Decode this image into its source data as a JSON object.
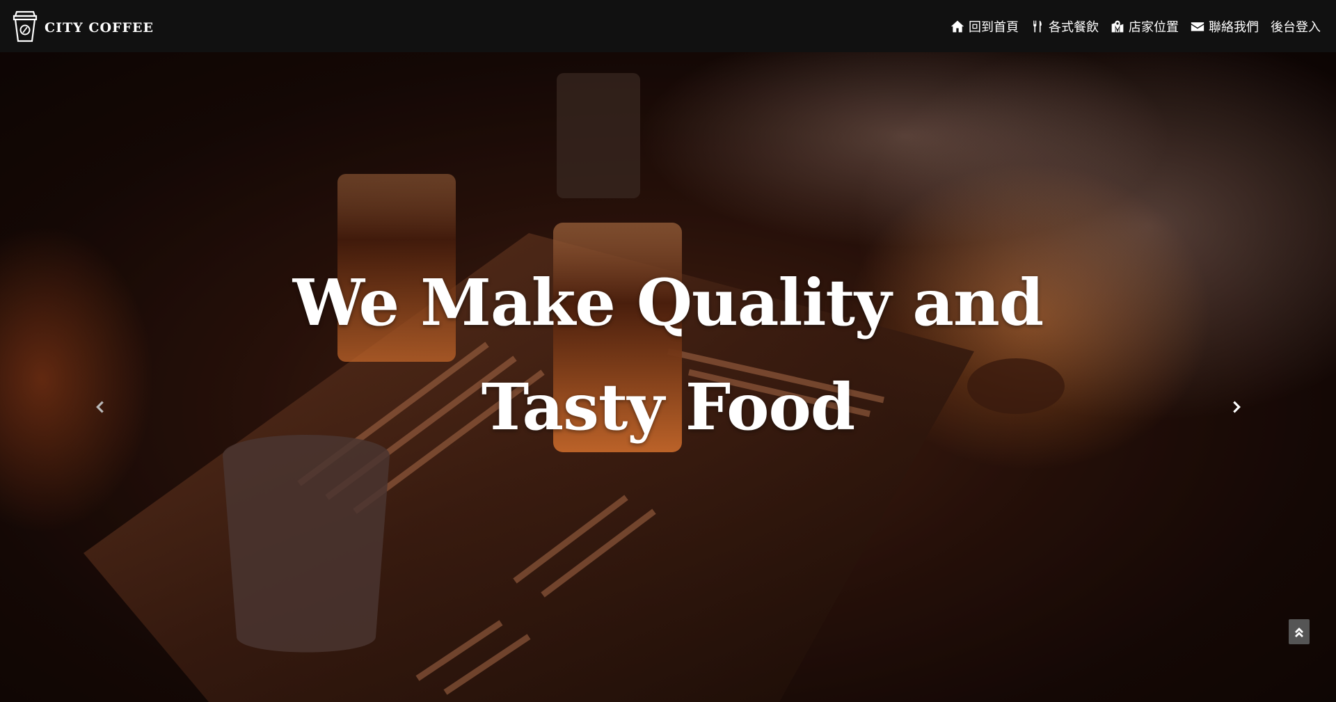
{
  "brand": {
    "name": "CITY COFFEE",
    "logo_icon": "coffee-cup-icon"
  },
  "nav": {
    "items": [
      {
        "label": "回到首頁",
        "icon": "home-icon"
      },
      {
        "label": "各式餐飲",
        "icon": "cutlery-icon"
      },
      {
        "label": "店家位置",
        "icon": "map-marker-icon"
      },
      {
        "label": "聯絡我們",
        "icon": "envelope-icon"
      },
      {
        "label": "後台登入",
        "icon": ""
      }
    ]
  },
  "hero": {
    "heading_line1": "We Make Quality and",
    "heading_line2": "Tasty Food",
    "prev_icon": "chevron-left-icon",
    "next_icon": "chevron-right-icon"
  },
  "back_to_top": {
    "icon": "double-chevron-up-icon"
  },
  "colors": {
    "navbar_bg": "#111111",
    "text": "#ffffff",
    "back_to_top_bg": "#555555"
  }
}
